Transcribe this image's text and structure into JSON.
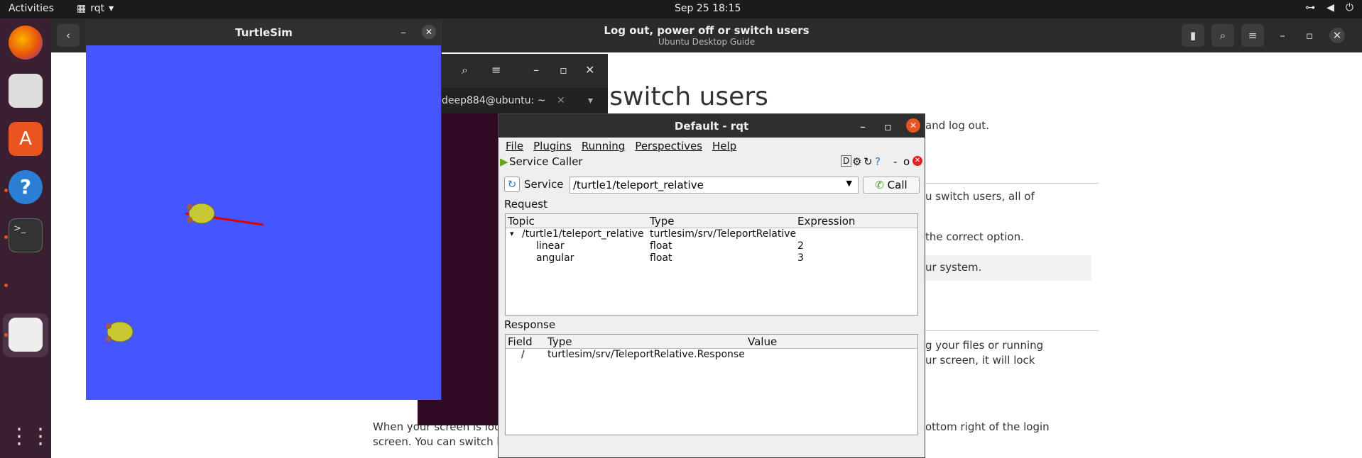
{
  "topbar": {
    "activities": "Activities",
    "app": "rqt",
    "clock": "Sep 25  18:15"
  },
  "help": {
    "title": "Log out, power off or switch users",
    "subtitle": "Ubuntu Desktop Guide",
    "heading": "r switch users",
    "lines": [
      "and log out.",
      "u switch users, all of",
      "the correct option.",
      "ur system.",
      "g your files or running",
      "ur screen, it will lock",
      "ottom right of the login",
      "When your screen is locke",
      "screen. You can switch bac"
    ]
  },
  "terminal": {
    "tab_label": "deep884@ubuntu: ~"
  },
  "turtlesim": {
    "title": "TurtleSim"
  },
  "rqt": {
    "title": "Default - rqt",
    "menu": [
      "File",
      "Plugins",
      "Running",
      "Perspectives",
      "Help"
    ],
    "plugin_title": "Service Caller",
    "plugin_buttons": "D",
    "service_label": "Service",
    "service_value": "/turtle1/teleport_relative",
    "call_label": "Call",
    "request_label": "Request",
    "request_headers": [
      "Topic",
      "Type",
      "Expression"
    ],
    "request_rows": [
      {
        "topic": "/turtle1/teleport_relative",
        "type": "turtlesim/srv/TeleportRelative",
        "expr": ""
      },
      {
        "topic": "linear",
        "type": "float",
        "expr": "2"
      },
      {
        "topic": "angular",
        "type": "float",
        "expr": "3"
      }
    ],
    "response_label": "Response",
    "response_headers": [
      "Field",
      "Type",
      "Value"
    ],
    "response_rows": [
      {
        "field": "/",
        "type": "turtlesim/srv/TeleportRelative.Response",
        "value": ""
      }
    ]
  }
}
